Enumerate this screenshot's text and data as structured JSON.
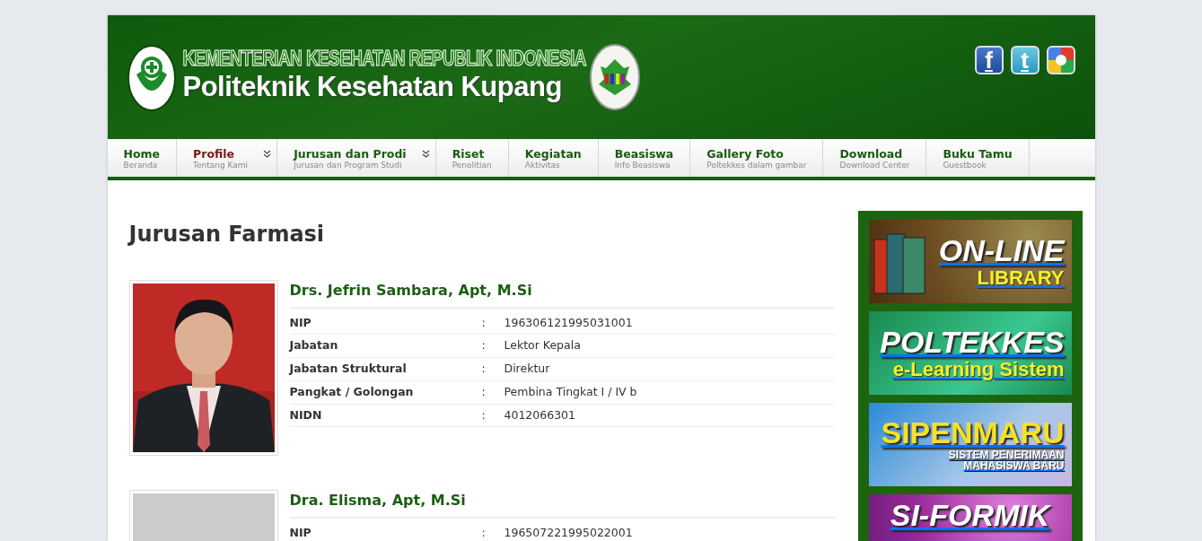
{
  "header": {
    "ministry": "KEMENTERIAN KESEHATAN REPUBLIK INDONESIA",
    "institution": "Politeknik Kesehatan Kupang",
    "social": [
      {
        "kind": "facebook",
        "glyph": "f"
      },
      {
        "kind": "twitter",
        "glyph": "t"
      },
      {
        "kind": "google"
      }
    ]
  },
  "nav": [
    {
      "label": "Home",
      "sub": "Beranda",
      "selected": false,
      "has_submenu": false
    },
    {
      "label": "Profile",
      "sub": "Tentang Kami",
      "selected": true,
      "has_submenu": true
    },
    {
      "label": "Jurusan dan Prodi",
      "sub": "Jurusan dan Program Studi",
      "selected": false,
      "has_submenu": true
    },
    {
      "label": "Riset",
      "sub": "Penelitian",
      "selected": false,
      "has_submenu": false
    },
    {
      "label": "Kegiatan",
      "sub": "Aktivitas",
      "selected": false,
      "has_submenu": false
    },
    {
      "label": "Beasiswa",
      "sub": "Info Beasiswa",
      "selected": false,
      "has_submenu": false
    },
    {
      "label": "Gallery Foto",
      "sub": "Poltekkes dalam gambar",
      "selected": false,
      "has_submenu": false
    },
    {
      "label": "Download",
      "sub": "Download Center",
      "selected": false,
      "has_submenu": false
    },
    {
      "label": "Buku Tamu",
      "sub": "Guestbook",
      "selected": false,
      "has_submenu": false
    }
  ],
  "page_title": "Jurusan Farmasi",
  "staff": [
    {
      "name": "Drs. Jefrin Sambara, Apt, M.Si",
      "kind": "picture",
      "fields": [
        {
          "label": "NIP",
          "sep": ":",
          "value": "196306121995031001"
        },
        {
          "label": "Jabatan",
          "sep": ":",
          "value": "Lektor Kepala"
        },
        {
          "label": "Jabatan Struktural",
          "sep": ":",
          "value": "Direktur"
        },
        {
          "label": "Pangkat / Golongan",
          "sep": ":",
          "value": "Pembina Tingkat I / IV b"
        },
        {
          "label": "NIDN",
          "sep": ":",
          "value": "4012066301"
        }
      ]
    },
    {
      "name": "Dra. Elisma, Apt, M.Si",
      "kind": "placeholder",
      "fields": [
        {
          "label": "NIP",
          "sep": ":",
          "value": "196507221995022001"
        }
      ]
    }
  ],
  "sidebar_banners": [
    {
      "kind": "library",
      "lines": [
        "ON-LINE",
        "LIBRARY"
      ]
    },
    {
      "kind": "elearning",
      "lines": [
        "POLTEKKES",
        "e-Learning Sistem"
      ]
    },
    {
      "kind": "sipenmaru",
      "lines": [
        "SIPENMARU",
        "SISTEM PENERIMAAN",
        "MAHASISWA BARU"
      ]
    },
    {
      "kind": "siformik",
      "lines": [
        "SI-FORMIK"
      ]
    }
  ]
}
